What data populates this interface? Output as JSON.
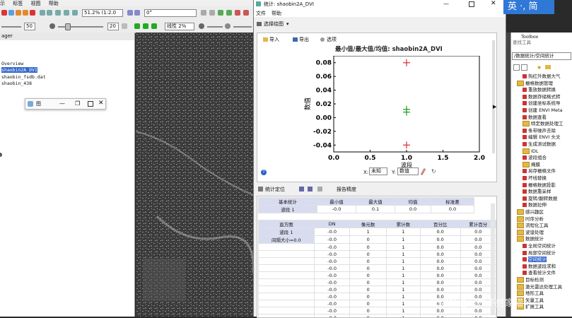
{
  "menubar": {
    "items": [
      "示",
      "标签",
      "视图",
      "帮助"
    ]
  },
  "toolbar1": {
    "zoom": "51.2% (1:2.0",
    "rotation": "0°"
  },
  "toolbar2": {
    "v1": "50",
    "v2": "20",
    "stretch": "线性 2%",
    "v3": "10"
  },
  "left_panel": {
    "title": "ager",
    "items": [
      "Overview",
      "shaobin2A_DVI",
      "shaobin_fsdb.dat",
      "shaobin_438"
    ],
    "selected_index": 1
  },
  "mini_window": {
    "label": "图"
  },
  "stats_window": {
    "title": "统计: shaobin2A_DVI",
    "menu": [
      "文件",
      "帮助"
    ],
    "select_chart": "选择绘图",
    "plot_toolbar": {
      "import": "导入",
      "export": "导出",
      "options": "选项"
    },
    "chart_data": {
      "type": "scatter",
      "title": "最小值/最大值/均值: shaobin2A_DVI",
      "xlabel": "波段",
      "ylabel": "数值",
      "xlim": [
        0.0,
        2.0
      ],
      "ylim": [
        -0.05,
        0.09
      ],
      "xticks": [
        "0.0",
        "0.5",
        "1.0",
        "1.5",
        "2.0"
      ],
      "yticks": [
        "-0.04",
        "-0.02",
        "0.00",
        "0.02",
        "0.04",
        "0.06",
        "0.08"
      ],
      "series": [
        {
          "name": "最小值",
          "color": "#e03030",
          "x": [
            1.0
          ],
          "y": [
            -0.04
          ]
        },
        {
          "name": "最大值",
          "color": "#e03030",
          "x": [
            1.0
          ],
          "y": [
            0.08
          ]
        },
        {
          "name": "均值",
          "color": "#20a020",
          "x": [
            1.0
          ],
          "y": [
            0.012
          ]
        },
        {
          "name": "均值",
          "color": "#20a020",
          "x": [
            1.0
          ],
          "y": [
            0.008
          ]
        }
      ],
      "grid": false
    },
    "plot_footer": {
      "x_label": "X:",
      "x_value": "未知",
      "y_label": "Y:",
      "y_value": "数值"
    },
    "table_toolbar": {
      "stats_position": "统计定位",
      "report_precision": "报告精度"
    },
    "basic_stats": {
      "headers": [
        "基本统计",
        "最小值",
        "最大值",
        "均值",
        "标准差"
      ],
      "rows": [
        [
          "波段 1",
          "-0.0",
          "0.1",
          "0.0",
          "0.0"
        ]
      ]
    },
    "histogram": {
      "headers": [
        "直方图",
        "DN",
        "像元数",
        "累计数",
        "百分比",
        "累计百分"
      ],
      "left_labels": [
        "波段 1",
        "间隔大小=0.0"
      ],
      "rows": [
        [
          "-0.0",
          "1",
          "1",
          "0.0",
          "0.0"
        ],
        [
          "-0.0",
          "0",
          "1",
          "0.0",
          "0.0"
        ],
        [
          "-0.0",
          "0",
          "1",
          "0.0",
          "0.0"
        ],
        [
          "-0.0",
          "0",
          "1",
          "0.0",
          "0.0"
        ],
        [
          "-0.0",
          "0",
          "1",
          "0.0",
          "0.0"
        ],
        [
          "-0.0",
          "0",
          "1",
          "0.0",
          "0.0"
        ],
        [
          "-0.0",
          "0",
          "1",
          "0.0",
          "0.0"
        ],
        [
          "-0.0",
          "0",
          "1",
          "0.0",
          "0.0"
        ],
        [
          "-0.0",
          "0",
          "1",
          "0.0",
          "0.0"
        ],
        [
          "-0.0",
          "0",
          "1",
          "0.0",
          "0.0"
        ],
        [
          "-0.0",
          "0",
          "1",
          "0.0",
          "0.0"
        ],
        [
          "-0.0",
          "0",
          "1",
          "0.0",
          "0.0"
        ],
        [
          "-0.0",
          "0",
          "1",
          "0.0",
          "0.0"
        ]
      ]
    }
  },
  "ime": {
    "text": "英 ·, 简"
  },
  "toolbox": {
    "title": "Toolbox",
    "search_label": "查找工具",
    "path": "/数据统计/空间统计",
    "items": [
      {
        "label": "热红外数据大气",
        "type": "tool",
        "indent": 2
      },
      {
        "label": "栅格数据管理",
        "type": "folder",
        "indent": 1
      },
      {
        "label": "重放数据转换",
        "type": "tool",
        "indent": 2
      },
      {
        "label": "数据存储格式转",
        "type": "tool",
        "indent": 2
      },
      {
        "label": "创建坐标系统导",
        "type": "tool",
        "indent": 2
      },
      {
        "label": "创建 ENVI Meta",
        "type": "tool",
        "indent": 2
      },
      {
        "label": "数据查看",
        "type": "tool",
        "indent": 2
      },
      {
        "label": "特定数据处理工",
        "type": "folder",
        "indent": 2
      },
      {
        "label": "条带噪声去除",
        "type": "tool",
        "indent": 2
      },
      {
        "label": "编辑 ENVI 头文",
        "type": "tool",
        "indent": 2
      },
      {
        "label": "生成测试数据",
        "type": "tool",
        "indent": 2
      },
      {
        "label": "IDL",
        "type": "folder",
        "indent": 2
      },
      {
        "label": "波段组合",
        "type": "tool",
        "indent": 2
      },
      {
        "label": "掩膜",
        "type": "folder",
        "indent": 2
      },
      {
        "label": "另存栅格文件",
        "type": "tool",
        "indent": 2
      },
      {
        "label": "坏线替换",
        "type": "tool",
        "indent": 2
      },
      {
        "label": "栅格数据投影",
        "type": "tool",
        "indent": 2
      },
      {
        "label": "数据重采样",
        "type": "tool",
        "indent": 2
      },
      {
        "label": "旋转/翻转数据",
        "type": "tool",
        "indent": 2
      },
      {
        "label": "数据拉伸",
        "type": "tool",
        "indent": 2
      },
      {
        "label": "感兴趣区",
        "type": "folder",
        "indent": 1
      },
      {
        "label": "时序分析",
        "type": "folder",
        "indent": 1
      },
      {
        "label": "流程化工具",
        "type": "folder",
        "indent": 1
      },
      {
        "label": "波谱处理",
        "type": "folder",
        "indent": 1
      },
      {
        "label": "数据统计",
        "type": "folder",
        "indent": 1
      },
      {
        "label": "全局空间统计",
        "type": "tool",
        "indent": 2
      },
      {
        "label": "局部空间统计",
        "type": "tool",
        "indent": 2
      },
      {
        "label": "空间统计",
        "type": "tool",
        "indent": 2
      },
      {
        "label": "数据波段求和",
        "type": "tool",
        "indent": 2
      },
      {
        "label": "查看统计文件",
        "type": "tool",
        "indent": 2
      },
      {
        "label": "目标检测",
        "type": "folder",
        "indent": 1
      },
      {
        "label": "激光雷达处理工具",
        "type": "folder",
        "indent": 1
      },
      {
        "label": "地形工具",
        "type": "folder",
        "indent": 1
      },
      {
        "label": "矢量工具",
        "type": "folder",
        "indent": 1
      },
      {
        "label": "扩展工具",
        "type": "folder",
        "indent": 1
      }
    ],
    "selected_label": "空间统计"
  },
  "watermark": "CSDN @房东不姓家猫"
}
